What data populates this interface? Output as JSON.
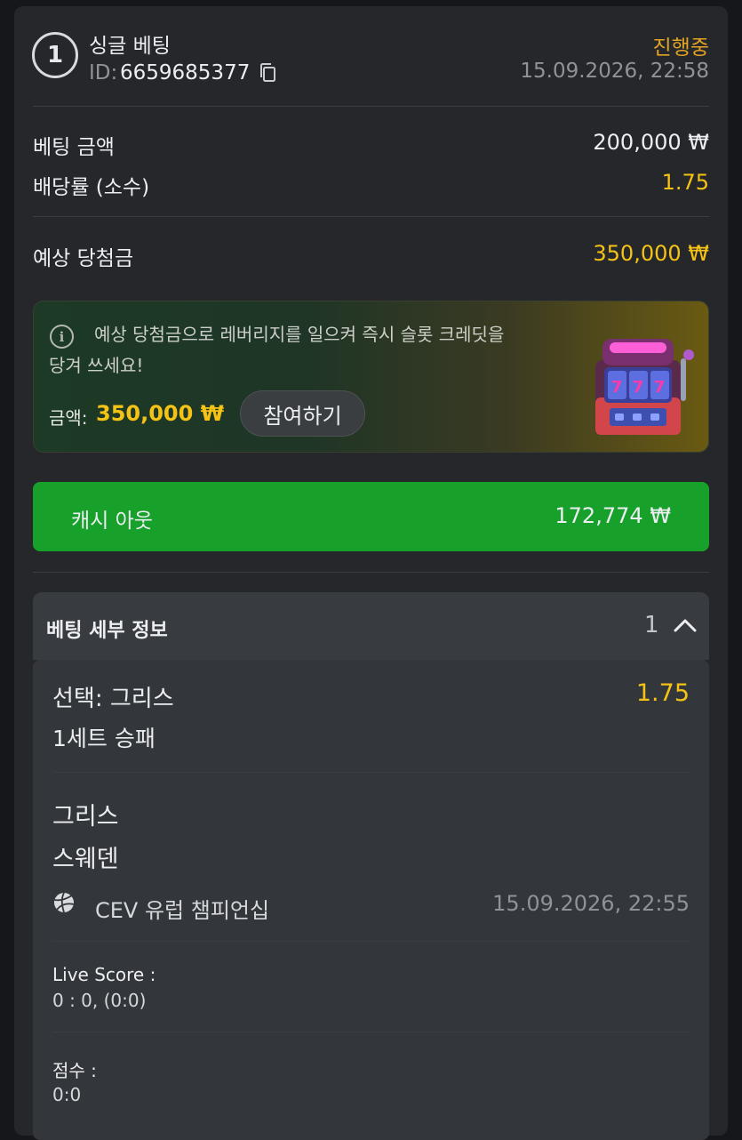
{
  "bet": {
    "number": "1",
    "type": "싱글 베팅",
    "id_label": "ID:",
    "id_value": "6659685377",
    "status": "진행중",
    "datetime": "15.09.2026, 22:58"
  },
  "summary": {
    "stake_label": "베팅 금액",
    "stake_value": "200,000 ₩",
    "odds_label": "배당률 (소수)",
    "odds_value": "1.75",
    "payout_label": "예상 당첨금",
    "payout_value": "350,000 ₩"
  },
  "promo": {
    "text_line1": "예상 당첨금으로 레버리지를 일으켜 즉시 슬롯 크레딧을",
    "text_line2": "당겨 쓰세요!",
    "amount_label": "금액:",
    "amount_value": "350,000 ₩",
    "button_label": "참여하기",
    "image_icon": "slot-machine-icon"
  },
  "cashout": {
    "label": "캐시 아웃",
    "value": "172,774 ₩",
    "color": "#17a12b"
  },
  "details": {
    "title": "베팅 세부 정보",
    "count": "1",
    "selection": "선택: 그리스",
    "selection_odds": "1.75",
    "market": "1세트 승패",
    "team1": "그리스",
    "team2": "스웨덴",
    "sport_icon": "volleyball-icon",
    "league": "CEV 유럽 챔피언십",
    "event_datetime": "15.09.2026, 22:55",
    "live_score_label": "Live Score :",
    "live_score_value": "0 : 0, (0:0)",
    "score_label": "점수 :",
    "score_value": "0:0"
  },
  "colors": {
    "background": "#15171b",
    "card": "#25272b",
    "accent_yellow": "#f5c315",
    "status_orange": "#e3a324"
  }
}
